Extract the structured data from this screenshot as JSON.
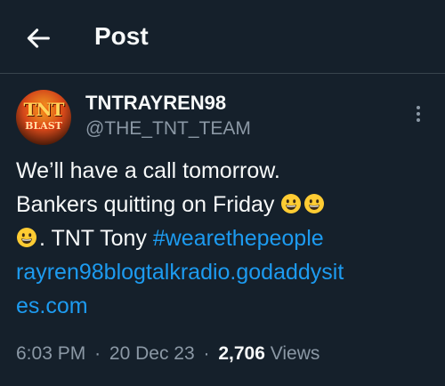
{
  "header": {
    "title": "Post",
    "back_icon": "arrow-left-icon"
  },
  "author": {
    "display_name": "TNTRAYREN98",
    "handle": "@THE_TNT_TEAM",
    "avatar_text_top": "TNT",
    "avatar_text_bottom": "BLAST",
    "more_icon": "more-vertical-icon"
  },
  "tweet": {
    "line1": "We’ll have a call tomorrow.",
    "line2_text": "Bankers quitting on Friday ",
    "line3_text": ". TNT Tony ",
    "hashtag": "#wearethepeople",
    "link_part1": "rayren98blogtalkradio.godaddysit",
    "link_part2": "es.com",
    "emoji_icon": "grinning-face-emoji-icon"
  },
  "meta": {
    "time": "6:03 PM",
    "separator": "·",
    "date": "20 Dec 23",
    "views_count": "2,706",
    "views_label": "Views"
  },
  "colors": {
    "background": "#15202b",
    "text": "#e7e9ea",
    "secondary_text": "#8b98a5",
    "link": "#1d9bf0",
    "divider": "#38444d"
  }
}
